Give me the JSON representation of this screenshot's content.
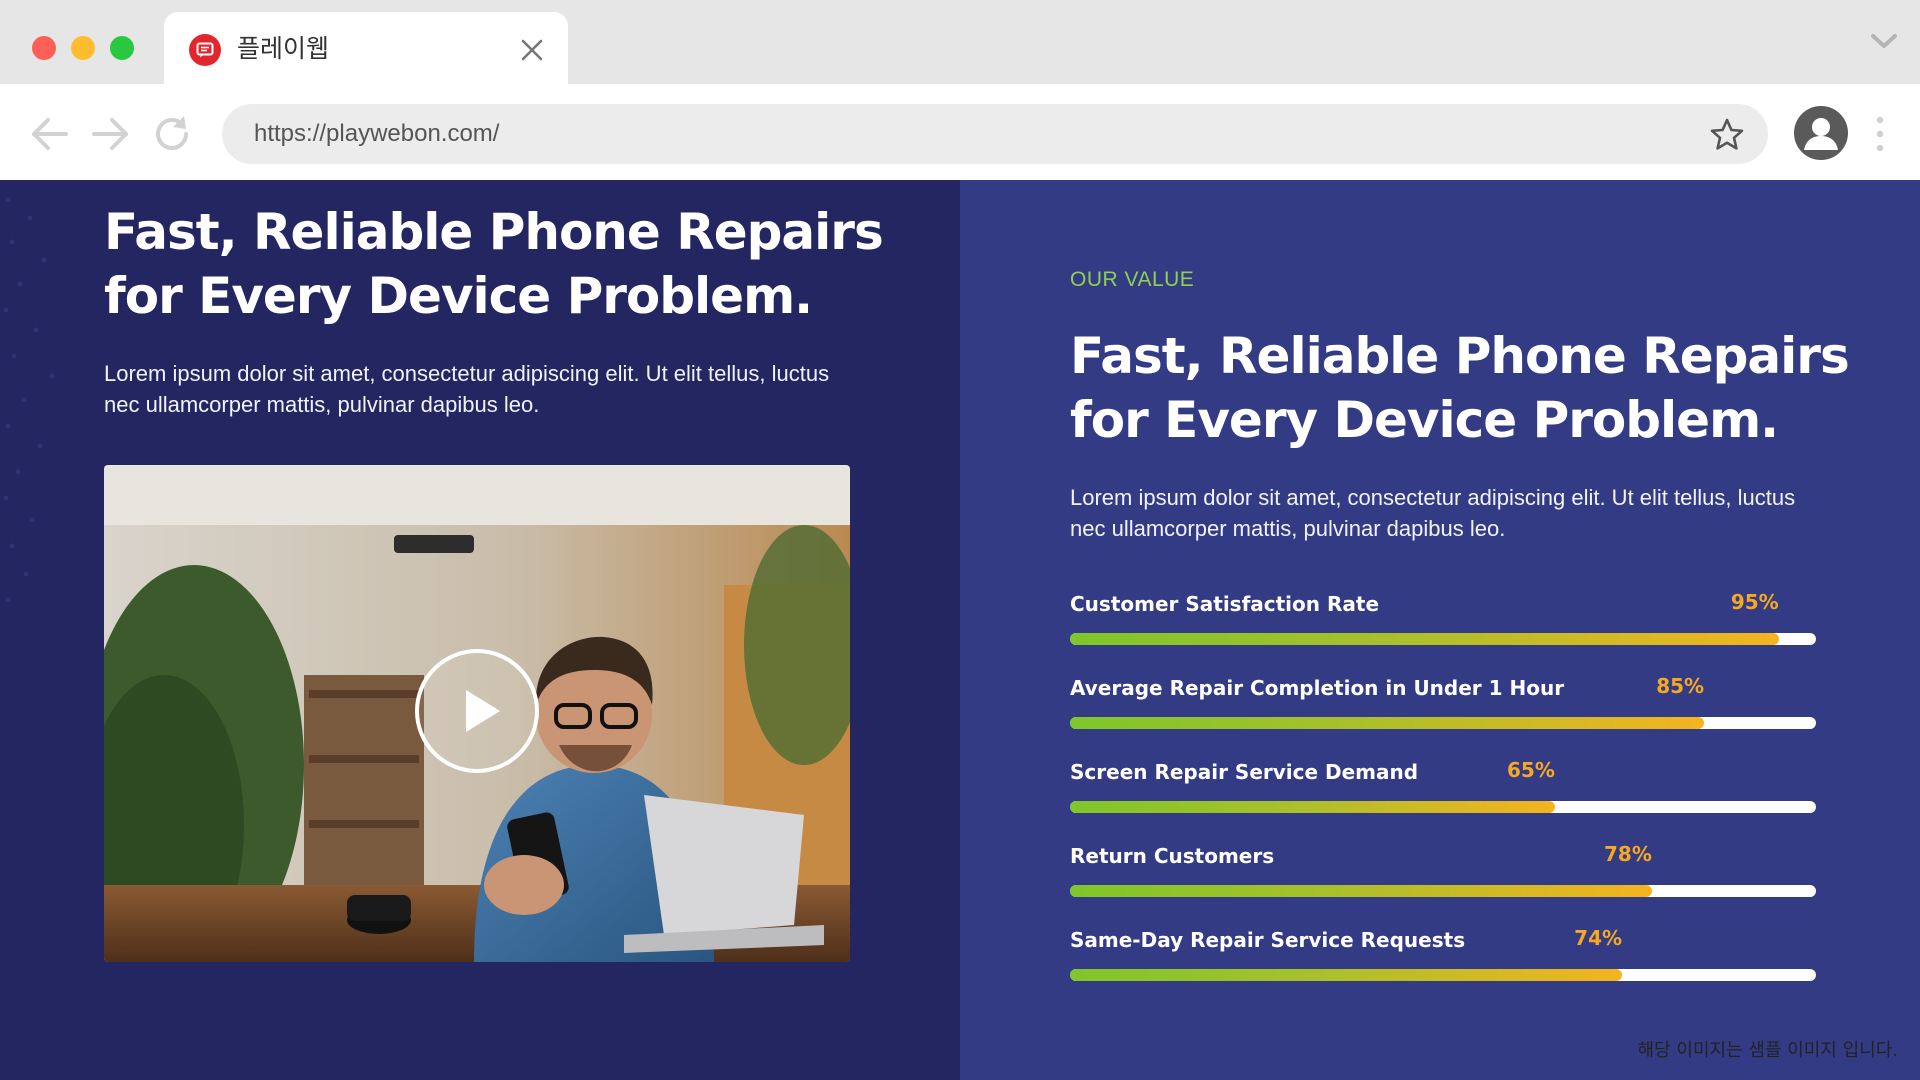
{
  "browser": {
    "tab_title": "플레이웹",
    "url": "https://playwebon.com/",
    "colors": {
      "close": "#fe5f57",
      "minimize": "#febc2e",
      "maximize": "#28c840",
      "favicon": "#e3262e"
    }
  },
  "left_panel": {
    "heading": "Fast, Reliable Phone Repairs for Every Device Problem.",
    "paragraph": "Lorem ipsum dolor sit amet, consectetur adipiscing elit. Ut elit tellus, luctus nec ullamcorper mattis, pulvinar dapibus leo.",
    "video": {
      "icon": "play-icon"
    }
  },
  "right_panel": {
    "eyebrow": "OUR VALUE",
    "heading": "Fast, Reliable Phone Repairs for Every Device Problem.",
    "paragraph": "Lorem ipsum dolor sit amet, consectetur adipiscing elit. Ut elit tellus, luctus nec ullamcorper mattis, pulvinar dapibus leo.",
    "skills": [
      {
        "label": "Customer Satisfaction Rate",
        "percent_text": "95%",
        "value": 95
      },
      {
        "label": "Average Repair Completion in Under 1 Hour",
        "percent_text": "85%",
        "value": 85
      },
      {
        "label": "Screen Repair Service Demand",
        "percent_text": "65%",
        "value": 65
      },
      {
        "label": "Return Customers",
        "percent_text": "78%",
        "value": 78
      },
      {
        "label": "Same-Day Repair Service Requests",
        "percent_text": "74%",
        "value": 74
      }
    ]
  },
  "theme": {
    "left_bg": "#232660",
    "right_bg": "#343b85",
    "accent_green": "#8fd14f",
    "accent_orange": "#f6a823"
  },
  "caption": "해당 이미지는 샘플 이미지 입니다."
}
